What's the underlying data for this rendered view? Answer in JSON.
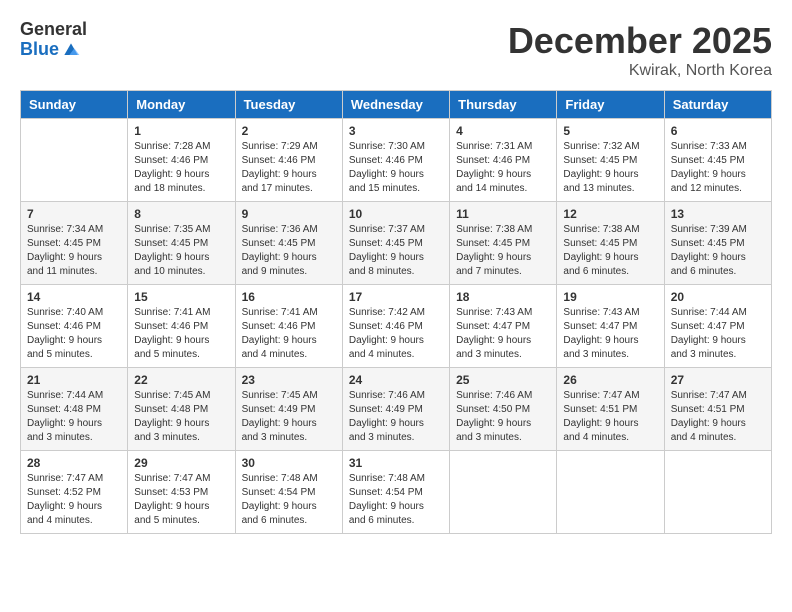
{
  "logo": {
    "general": "General",
    "blue": "Blue"
  },
  "title": "December 2025",
  "location": "Kwirak, North Korea",
  "days_of_week": [
    "Sunday",
    "Monday",
    "Tuesday",
    "Wednesday",
    "Thursday",
    "Friday",
    "Saturday"
  ],
  "weeks": [
    [
      {
        "day": "",
        "info": ""
      },
      {
        "day": "1",
        "info": "Sunrise: 7:28 AM\nSunset: 4:46 PM\nDaylight: 9 hours\nand 18 minutes."
      },
      {
        "day": "2",
        "info": "Sunrise: 7:29 AM\nSunset: 4:46 PM\nDaylight: 9 hours\nand 17 minutes."
      },
      {
        "day": "3",
        "info": "Sunrise: 7:30 AM\nSunset: 4:46 PM\nDaylight: 9 hours\nand 15 minutes."
      },
      {
        "day": "4",
        "info": "Sunrise: 7:31 AM\nSunset: 4:46 PM\nDaylight: 9 hours\nand 14 minutes."
      },
      {
        "day": "5",
        "info": "Sunrise: 7:32 AM\nSunset: 4:45 PM\nDaylight: 9 hours\nand 13 minutes."
      },
      {
        "day": "6",
        "info": "Sunrise: 7:33 AM\nSunset: 4:45 PM\nDaylight: 9 hours\nand 12 minutes."
      }
    ],
    [
      {
        "day": "7",
        "info": "Sunrise: 7:34 AM\nSunset: 4:45 PM\nDaylight: 9 hours\nand 11 minutes."
      },
      {
        "day": "8",
        "info": "Sunrise: 7:35 AM\nSunset: 4:45 PM\nDaylight: 9 hours\nand 10 minutes."
      },
      {
        "day": "9",
        "info": "Sunrise: 7:36 AM\nSunset: 4:45 PM\nDaylight: 9 hours\nand 9 minutes."
      },
      {
        "day": "10",
        "info": "Sunrise: 7:37 AM\nSunset: 4:45 PM\nDaylight: 9 hours\nand 8 minutes."
      },
      {
        "day": "11",
        "info": "Sunrise: 7:38 AM\nSunset: 4:45 PM\nDaylight: 9 hours\nand 7 minutes."
      },
      {
        "day": "12",
        "info": "Sunrise: 7:38 AM\nSunset: 4:45 PM\nDaylight: 9 hours\nand 6 minutes."
      },
      {
        "day": "13",
        "info": "Sunrise: 7:39 AM\nSunset: 4:45 PM\nDaylight: 9 hours\nand 6 minutes."
      }
    ],
    [
      {
        "day": "14",
        "info": "Sunrise: 7:40 AM\nSunset: 4:46 PM\nDaylight: 9 hours\nand 5 minutes."
      },
      {
        "day": "15",
        "info": "Sunrise: 7:41 AM\nSunset: 4:46 PM\nDaylight: 9 hours\nand 5 minutes."
      },
      {
        "day": "16",
        "info": "Sunrise: 7:41 AM\nSunset: 4:46 PM\nDaylight: 9 hours\nand 4 minutes."
      },
      {
        "day": "17",
        "info": "Sunrise: 7:42 AM\nSunset: 4:46 PM\nDaylight: 9 hours\nand 4 minutes."
      },
      {
        "day": "18",
        "info": "Sunrise: 7:43 AM\nSunset: 4:47 PM\nDaylight: 9 hours\nand 3 minutes."
      },
      {
        "day": "19",
        "info": "Sunrise: 7:43 AM\nSunset: 4:47 PM\nDaylight: 9 hours\nand 3 minutes."
      },
      {
        "day": "20",
        "info": "Sunrise: 7:44 AM\nSunset: 4:47 PM\nDaylight: 9 hours\nand 3 minutes."
      }
    ],
    [
      {
        "day": "21",
        "info": "Sunrise: 7:44 AM\nSunset: 4:48 PM\nDaylight: 9 hours\nand 3 minutes."
      },
      {
        "day": "22",
        "info": "Sunrise: 7:45 AM\nSunset: 4:48 PM\nDaylight: 9 hours\nand 3 minutes."
      },
      {
        "day": "23",
        "info": "Sunrise: 7:45 AM\nSunset: 4:49 PM\nDaylight: 9 hours\nand 3 minutes."
      },
      {
        "day": "24",
        "info": "Sunrise: 7:46 AM\nSunset: 4:49 PM\nDaylight: 9 hours\nand 3 minutes."
      },
      {
        "day": "25",
        "info": "Sunrise: 7:46 AM\nSunset: 4:50 PM\nDaylight: 9 hours\nand 3 minutes."
      },
      {
        "day": "26",
        "info": "Sunrise: 7:47 AM\nSunset: 4:51 PM\nDaylight: 9 hours\nand 4 minutes."
      },
      {
        "day": "27",
        "info": "Sunrise: 7:47 AM\nSunset: 4:51 PM\nDaylight: 9 hours\nand 4 minutes."
      }
    ],
    [
      {
        "day": "28",
        "info": "Sunrise: 7:47 AM\nSunset: 4:52 PM\nDaylight: 9 hours\nand 4 minutes."
      },
      {
        "day": "29",
        "info": "Sunrise: 7:47 AM\nSunset: 4:53 PM\nDaylight: 9 hours\nand 5 minutes."
      },
      {
        "day": "30",
        "info": "Sunrise: 7:48 AM\nSunset: 4:54 PM\nDaylight: 9 hours\nand 6 minutes."
      },
      {
        "day": "31",
        "info": "Sunrise: 7:48 AM\nSunset: 4:54 PM\nDaylight: 9 hours\nand 6 minutes."
      },
      {
        "day": "",
        "info": ""
      },
      {
        "day": "",
        "info": ""
      },
      {
        "day": "",
        "info": ""
      }
    ]
  ]
}
